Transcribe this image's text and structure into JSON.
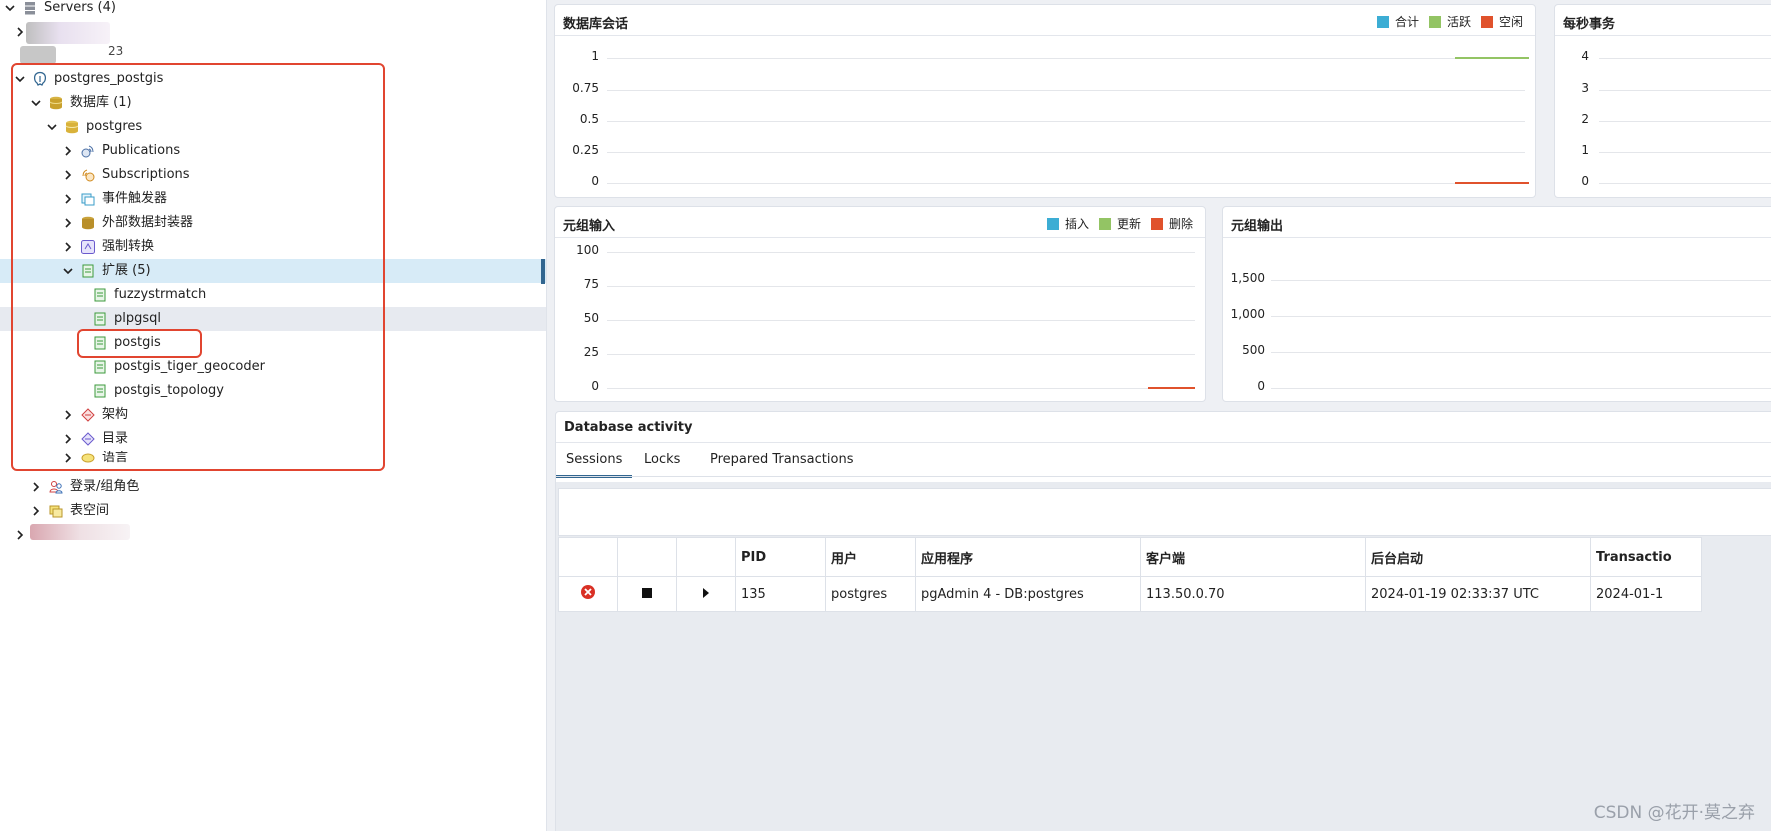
{
  "tree": {
    "servers_label": "Servers (4)",
    "blurred_label_1": "...",
    "blurred_label_2": "23",
    "server": "postgres_postgis",
    "databases": "数据库 (1)",
    "database": "postgres",
    "items": [
      {
        "label": "Publications",
        "icon": "publications-icon"
      },
      {
        "label": "Subscriptions",
        "icon": "subscriptions-icon"
      },
      {
        "label": "事件触发器",
        "icon": "event-trigger-icon"
      },
      {
        "label": "外部数据封装器",
        "icon": "fdw-icon"
      },
      {
        "label": "强制转换",
        "icon": "cast-icon"
      }
    ],
    "extensions": "扩展 (5)",
    "extension_items": [
      "fuzzystrmatch",
      "plpgsql",
      "postgis",
      "postgis_tiger_geocoder",
      "postgis_topology"
    ],
    "schemas": "架构",
    "catalogs": "目录",
    "languages": "语言",
    "login_roles": "登录/组角色",
    "tablespaces": "表空间"
  },
  "charts": {
    "sessions": {
      "title": "数据库会话",
      "legend": [
        {
          "name": "合计",
          "color": "#3cadd4"
        },
        {
          "name": "活跃",
          "color": "#93c464"
        },
        {
          "name": "空闲",
          "color": "#e0522c"
        }
      ],
      "yticks": [
        "1",
        "0.75",
        "0.5",
        "0.25",
        "0"
      ]
    },
    "tps": {
      "title": "每秒事务",
      "yticks": [
        "4",
        "3",
        "2",
        "1",
        "0"
      ]
    },
    "tuples_in": {
      "title": "元组输入",
      "legend": [
        {
          "name": "插入",
          "color": "#3cadd4"
        },
        {
          "name": "更新",
          "color": "#93c464"
        },
        {
          "name": "删除",
          "color": "#e0522c"
        }
      ],
      "yticks": [
        "100",
        "75",
        "50",
        "25",
        "0"
      ]
    },
    "tuples_out": {
      "title": "元组输出",
      "yticks": [
        "1,500",
        "1,000",
        "500",
        "0"
      ]
    }
  },
  "activity": {
    "title": "Database activity",
    "tabs": [
      "Sessions",
      "Locks",
      "Prepared Transactions"
    ],
    "columns": [
      "PID",
      "用户",
      "应用程序",
      "客户端",
      "后台启动",
      "Transactio"
    ],
    "rows": [
      {
        "pid": "135",
        "user": "postgres",
        "app": "pgAdmin 4 - DB:postgres",
        "client": "113.50.0.70",
        "backend_start": "2024-01-19 02:33:37 UTC",
        "transaction": "2024-01-1"
      }
    ]
  },
  "watermark": "CSDN @花开·莫之弃"
}
